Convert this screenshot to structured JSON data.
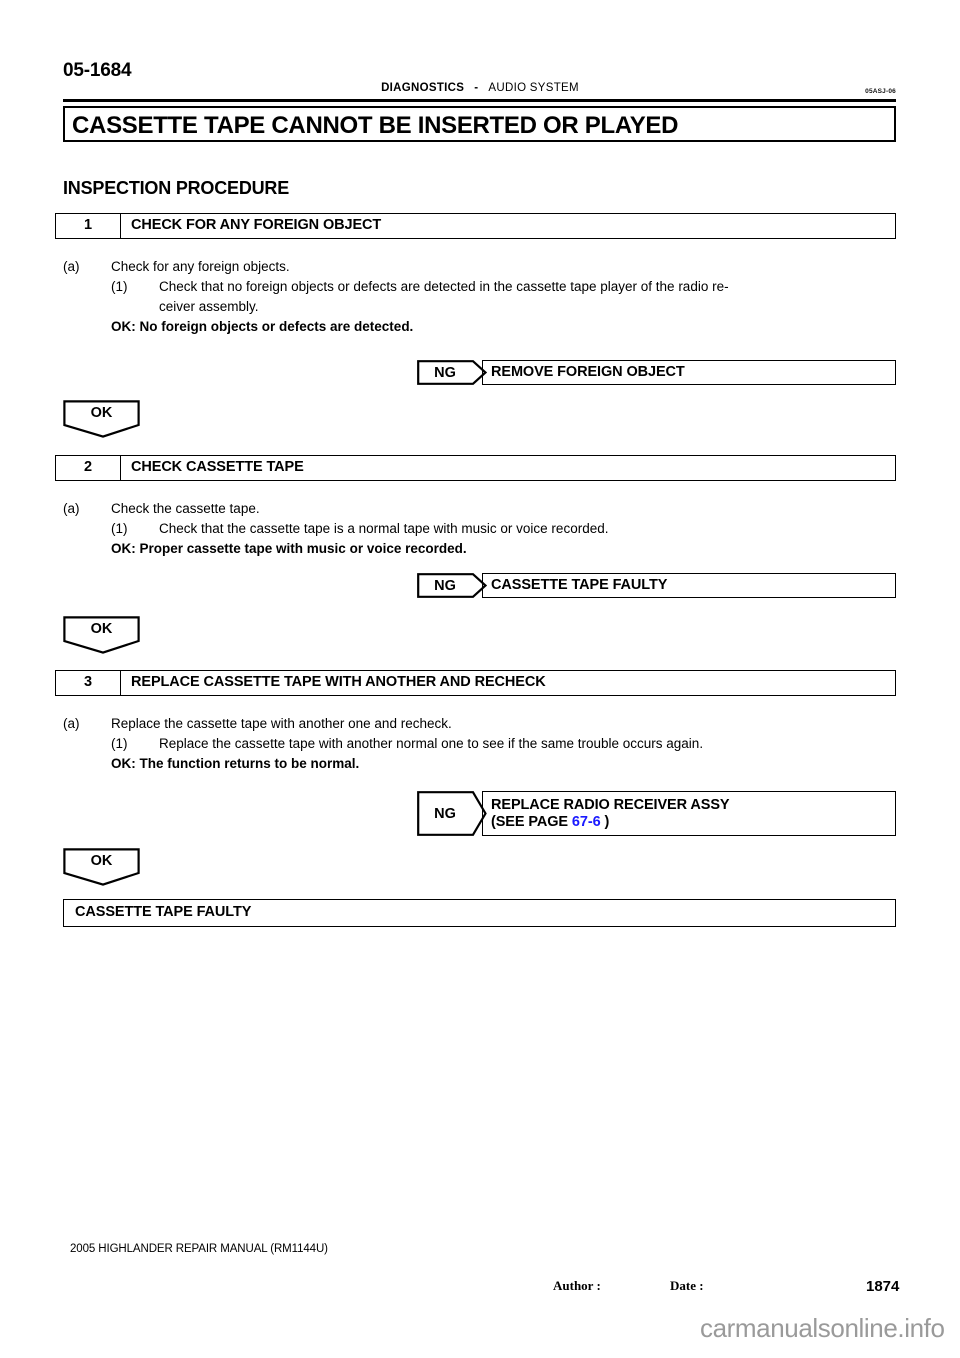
{
  "header": {
    "page_number": "05-1684",
    "section": "DIAGNOSTICS",
    "separator": "-",
    "system": "AUDIO SYSTEM",
    "doc_code": "05ASJ-06"
  },
  "title": "CASSETTE TAPE CANNOT BE INSERTED OR PLAYED",
  "section_heading": "INSPECTION PROCEDURE",
  "steps": [
    {
      "number": "1",
      "label": "CHECK FOR ANY FOREIGN OBJECT",
      "item_marker": "(a)",
      "item_text": "Check for any foreign objects.",
      "sub_marker": "(1)",
      "sub_text_line1": "Check that no foreign objects or defects are detected in the cassette tape player of the radio re-",
      "sub_text_line2": "ceiver assembly.",
      "ok_criteria": "OK: No foreign objects or defects are detected.",
      "ng_label": "NG",
      "ng_result_line1": "REMOVE FOREIGN OBJECT",
      "ng_result_line2": "",
      "ok_label": "OK"
    },
    {
      "number": "2",
      "label": "CHECK CASSETTE TAPE",
      "item_marker": "(a)",
      "item_text": "Check the cassette tape.",
      "sub_marker": "(1)",
      "sub_text_line1": "Check that the cassette tape is a normal tape with music or voice recorded.",
      "sub_text_line2": "",
      "ok_criteria": "OK: Proper cassette tape with music or voice recorded.",
      "ng_label": "NG",
      "ng_result_line1": "CASSETTE TAPE FAULTY",
      "ng_result_line2": "",
      "ok_label": "OK"
    },
    {
      "number": "3",
      "label": "REPLACE CASSETTE TAPE WITH ANOTHER AND RECHECK",
      "item_marker": "(a)",
      "item_text": "Replace the cassette tape with another one and recheck.",
      "sub_marker": "(1)",
      "sub_text_line1": "Replace the cassette tape with another normal one to see if the same trouble occurs again.",
      "sub_text_line2": "",
      "ok_criteria": "OK: The function returns to be normal.",
      "ng_label": "NG",
      "ng_result_line1": "REPLACE RADIO RECEIVER ASSY",
      "ng_result_line2_pre": "(SEE PAGE ",
      "ng_result_link": "67-6",
      "ng_result_line2_post": " )",
      "ok_label": "OK"
    }
  ],
  "conclusion": "CASSETTE TAPE FAULTY",
  "footer": {
    "manual": "2005 HIGHLANDER REPAIR MANUAL   (RM1144U)",
    "author_label": "Author :",
    "date_label": "Date :",
    "page_number": "1874",
    "watermark": "carmanualsonline.info"
  },
  "colors": {
    "link": "#1a1aff",
    "text": "#000000",
    "watermark": "#9a9a9a"
  }
}
